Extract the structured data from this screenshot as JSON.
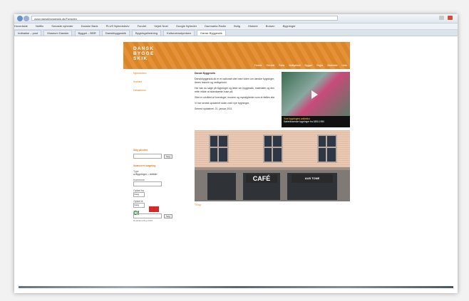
{
  "browser": {
    "address": "www.danskbyggeskik.dk/Forsiden",
    "bookmarks": [
      "Hovedside",
      "Netflix",
      "Senaste nyheder",
      "Danske Bank",
      "PLUS Nyhedsbrev",
      "Fundet",
      "Vejret Noel",
      "Google Nyheder",
      "Danmarks Radio",
      "Bolig",
      "Historie",
      "Borsen",
      "Bygninger"
    ],
    "tabs": [
      "Indbakke – post",
      "Museum Danske",
      "Bygget – BBR",
      "Danskbyggeskik",
      "Bygningsfredning",
      "Kulturarvsstyrelsen",
      "Dansk Byggeskik"
    ],
    "active_tab_index": 6
  },
  "site": {
    "logo_lines": [
      "DANSK",
      "BYGGE",
      "SKIK"
    ],
    "topnav": [
      "Forside",
      "Om sitet",
      "Fakta",
      "Vedligehold",
      "Byggeri",
      "Regler",
      "Materialer",
      "Links"
    ],
    "left_links": [
      "Nyhedsbrev",
      "Kontakt",
      "Debatforum"
    ],
    "search": {
      "title": "Søg på sitet",
      "button": "Søg"
    },
    "advanced": {
      "title": "Avanceret søgning",
      "type_label": "Type",
      "radio_a": "Bygninger",
      "radio_b": "Artikler",
      "municipality_label": "Kommune",
      "from_label": "Opført fra",
      "to_label": "Opført til",
      "select_val": "Vælg",
      "text_label": "Tekst",
      "button": "Søg"
    },
    "main": {
      "title": "Dansk Byggeskik",
      "p1": "Danskbyggeskik.dk er et nationalt sitet med viden om danske bygninger, deres historie og vedligehold.",
      "p2": "Her kan du søge på bygninger og læse om byggeskik, materialer og den rette måde at istandsætte huse på.",
      "p3": "Sitet er udviklet af foreninger, museer og myndigheder som et fælles site.",
      "p4": "Vi har senest opdateret siden med nye bygninger.",
      "updated": "Senest opdateret: 21. januar 2011"
    },
    "video": {
      "title": "Vore bygningers arkitektur",
      "sub": "Københavnske bygninger fra 1850-1950"
    },
    "photo": {
      "sign_left": "CAFÉ",
      "sign_right": "AUS TONE"
    },
    "caption": "Til top",
    "footer": {
      "text": "Realdania Byg 2010"
    }
  }
}
